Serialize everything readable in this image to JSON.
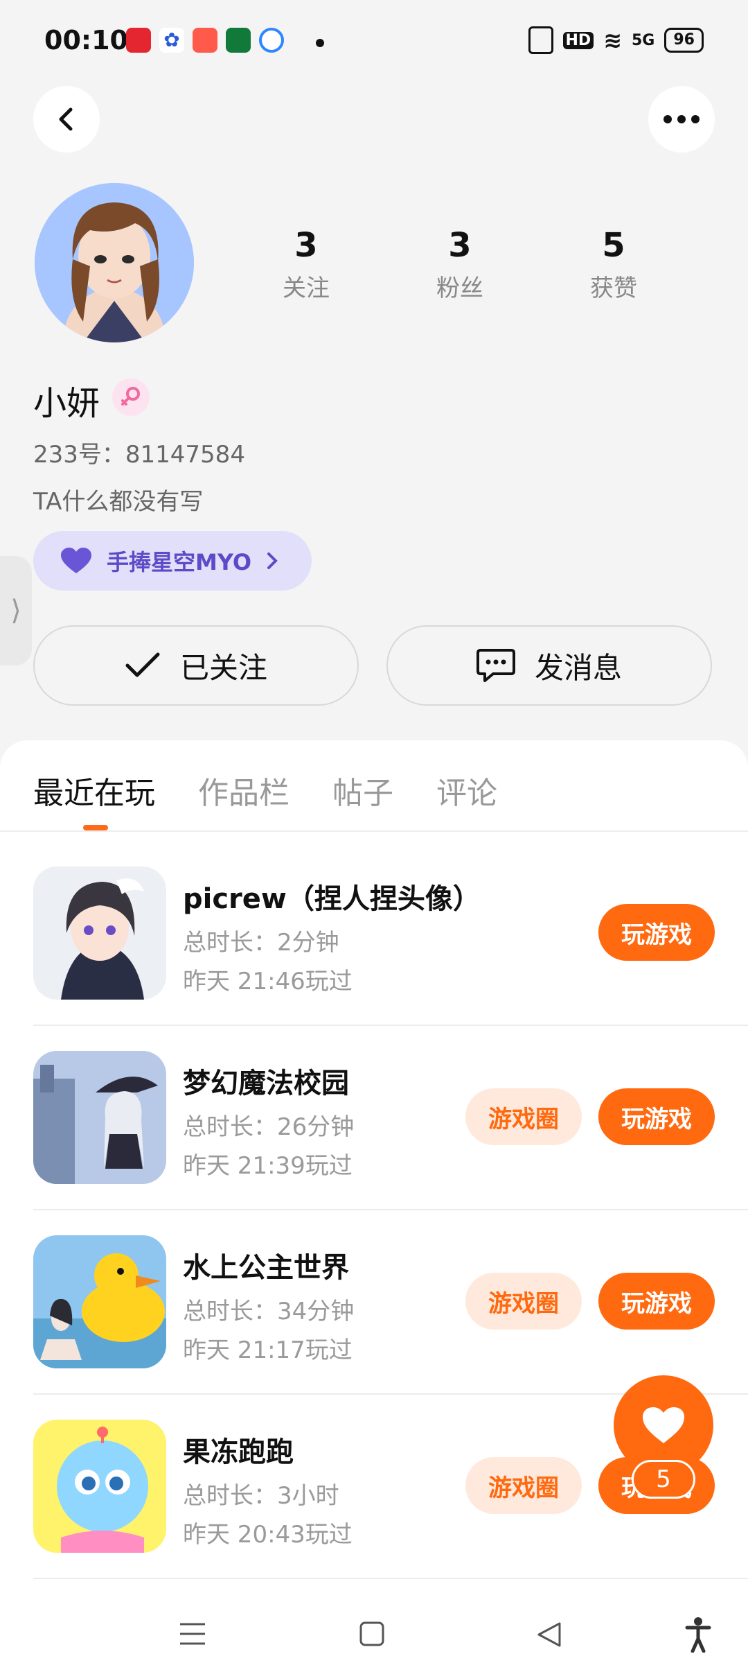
{
  "status_bar": {
    "time": "00:10",
    "battery": "96",
    "network": "5G",
    "hd": "HD"
  },
  "profile": {
    "stats": [
      {
        "num": "3",
        "label": "关注"
      },
      {
        "num": "3",
        "label": "粉丝"
      },
      {
        "num": "5",
        "label": "获赞"
      }
    ],
    "name": "小妍",
    "id_line": "233号：81147584",
    "bio": "TA什么都没有写",
    "badge": "手捧星空MYO",
    "follow_label": "已关注",
    "message_label": "发消息"
  },
  "tabs": [
    {
      "label": "最近在玩"
    },
    {
      "label": "作品栏"
    },
    {
      "label": "帖子"
    },
    {
      "label": "评论"
    }
  ],
  "games": [
    {
      "title": "picrew（捏人捏头像）",
      "duration": "总时长：2分钟",
      "last_played": "昨天 21:46玩过",
      "circle": "",
      "play": "玩游戏"
    },
    {
      "title": "梦幻魔法校园",
      "duration": "总时长：26分钟",
      "last_played": "昨天 21:39玩过",
      "circle": "游戏圈",
      "play": "玩游戏"
    },
    {
      "title": "水上公主世界",
      "duration": "总时长：34分钟",
      "last_played": "昨天 21:17玩过",
      "circle": "游戏圈",
      "play": "玩游戏"
    },
    {
      "title": "果冻跑跑",
      "duration": "总时长：3小时",
      "last_played": "昨天 20:43玩过",
      "circle": "游戏圈",
      "play": "玩游戏"
    }
  ],
  "fab": {
    "count": "5"
  },
  "colors": {
    "accent": "#ff6a10",
    "badge_bg": "#e2dffa",
    "badge_text": "#5b4bc7"
  }
}
